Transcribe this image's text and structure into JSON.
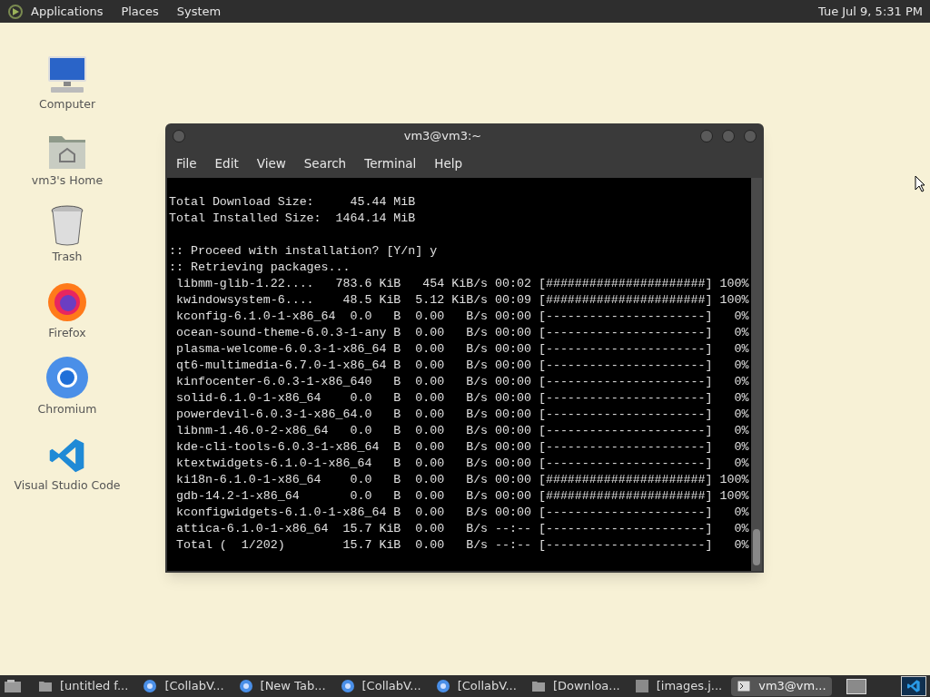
{
  "top_panel": {
    "menus": [
      "Applications",
      "Places",
      "System"
    ],
    "clock": "Tue Jul 9,  5:31 PM"
  },
  "desktop_icons": [
    {
      "kind": "computer",
      "label": "Computer"
    },
    {
      "kind": "home",
      "label": "vm3's Home"
    },
    {
      "kind": "trash",
      "label": "Trash"
    },
    {
      "kind": "firefox",
      "label": "Firefox"
    },
    {
      "kind": "chromium",
      "label": "Chromium"
    },
    {
      "kind": "vscode",
      "label": "Visual Studio Code"
    }
  ],
  "terminal": {
    "title": "vm3@vm3:~",
    "menu": [
      "File",
      "Edit",
      "View",
      "Search",
      "Terminal",
      "Help"
    ],
    "blocks": [
      [
        "Total Download Size:     45.44 MiB",
        "Total Installed Size:  1464.14 MiB"
      ],
      [
        ":: Proceed with installation? [Y/n] y",
        ":: Retrieving packages...",
        " libmm-glib-1.22....   783.6 KiB   454 KiB/s 00:02 [######################] 100%",
        " kwindowsystem-6....    48.5 KiB  5.12 KiB/s 00:09 [######################] 100%",
        " kconfig-6.1.0-1-x86_64  0.0   B  0.00   B/s 00:00 [----------------------]   0%",
        " ocean-sound-theme-6.0.3-1-any B  0.00   B/s 00:00 [----------------------]   0%",
        " plasma-welcome-6.0.3-1-x86_64 B  0.00   B/s 00:00 [----------------------]   0%",
        " qt6-multimedia-6.7.0-1-x86_64 B  0.00   B/s 00:00 [----------------------]   0%",
        " kinfocenter-6.0.3-1-x86_640   B  0.00   B/s 00:00 [----------------------]   0%",
        " solid-6.1.0-1-x86_64    0.0   B  0.00   B/s 00:00 [----------------------]   0%",
        " powerdevil-6.0.3-1-x86_64.0   B  0.00   B/s 00:00 [----------------------]   0%",
        " libnm-1.46.0-2-x86_64   0.0   B  0.00   B/s 00:00 [----------------------]   0%",
        " kde-cli-tools-6.0.3-1-x86_64  B  0.00   B/s 00:00 [----------------------]   0%",
        " ktextwidgets-6.1.0-1-x86_64   B  0.00   B/s 00:00 [----------------------]   0%",
        " ki18n-6.1.0-1-x86_64    0.0   B  0.00   B/s 00:00 [######################] 100%",
        " gdb-14.2-1-x86_64       0.0   B  0.00   B/s 00:00 [######################] 100%",
        " kconfigwidgets-6.1.0-1-x86_64 B  0.00   B/s 00:00 [----------------------]   0%",
        " attica-6.1.0-1-x86_64  15.7 KiB  0.00   B/s --:-- [----------------------]   0%",
        " Total (  1/202)        15.7 KiB  0.00   B/s --:-- [----------------------]   0%"
      ]
    ]
  },
  "taskbar": {
    "items": [
      {
        "kind": "folder",
        "label": "[untitled f...",
        "selected": false
      },
      {
        "kind": "browser",
        "label": "[CollabV...",
        "selected": false
      },
      {
        "kind": "browser",
        "label": "[New Tab...",
        "selected": false
      },
      {
        "kind": "browser",
        "label": "[CollabV...",
        "selected": false
      },
      {
        "kind": "browser",
        "label": "[CollabV...",
        "selected": false
      },
      {
        "kind": "folder",
        "label": "[Downloa...",
        "selected": false
      },
      {
        "kind": "image",
        "label": "[images.j...",
        "selected": false
      },
      {
        "kind": "terminal",
        "label": "vm3@vm...",
        "selected": true
      }
    ]
  }
}
